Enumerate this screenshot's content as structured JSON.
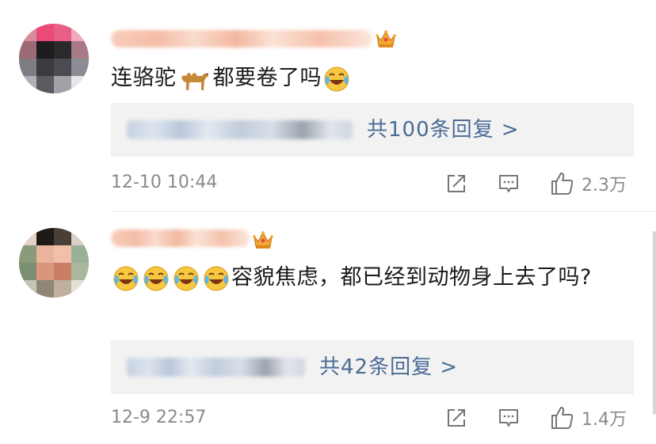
{
  "comments": [
    {
      "text_before": "连骆驼",
      "text_after": "都要卷了吗",
      "replies_label": "共100条回复 >",
      "time": "12-10 10:44",
      "likes": "2.3万",
      "icons": [
        "crown-badge-icon",
        "camel-emoji",
        "laugh-cry-emoji",
        "share-icon",
        "comment-icon",
        "thumbs-up-icon"
      ]
    },
    {
      "text": "容貌焦虑，都已经到动物身上去了吗?",
      "replies_label": "共42条回复 >",
      "time": "12-9 22:57",
      "likes": "1.4万",
      "icons": [
        "crown-badge-icon",
        "laugh-cry-emoji",
        "share-icon",
        "comment-icon",
        "thumbs-up-icon"
      ]
    }
  ],
  "colors": {
    "link": "#4b6c96",
    "meta": "#8a8a8a",
    "reply_bg": "#f2f2f2",
    "crown": "#f0a030"
  }
}
